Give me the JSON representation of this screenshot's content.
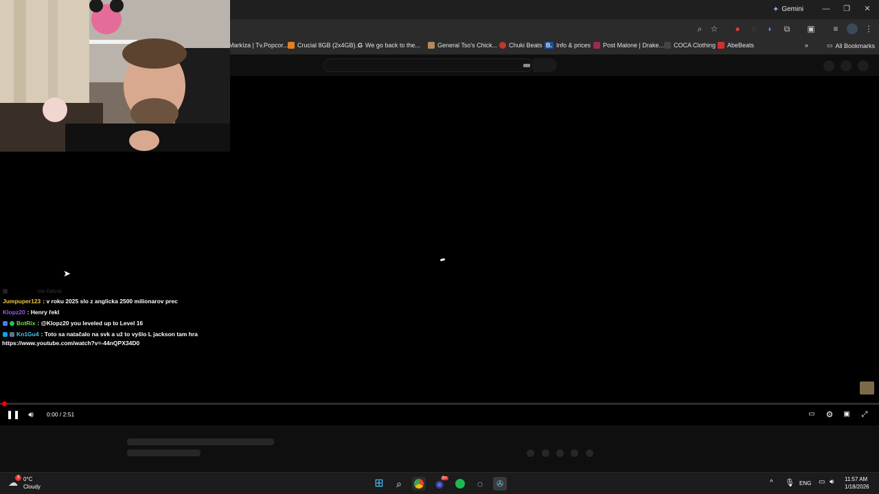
{
  "browser": {
    "gemini_label": "Gemini",
    "bookmarks": [
      {
        "label": "Markíza | Tv.Popcor...",
        "color": "#c0392b"
      },
      {
        "label": "Crucial 8GB (2x4GB)...",
        "color": "#e67e22"
      },
      {
        "label": "We go back to the...",
        "icon": "G"
      },
      {
        "label": "General Tso's Chick...",
        "color": "#b58a5a"
      },
      {
        "label": "Chuki Beats",
        "color": "#c0392b"
      },
      {
        "label": "Info & prices",
        "icon": "B."
      },
      {
        "label": "Post Malone | Drake...",
        "color": "#9b2c4a"
      },
      {
        "label": "COCA Clothing",
        "color": "#444444"
      },
      {
        "label": "AbeBeats",
        "color": "#d32f2f"
      }
    ],
    "all_bookmarks_label": "All Bookmarks"
  },
  "chat": {
    "faded": "nie četval",
    "messages": [
      {
        "user": "Jumpuper123",
        "user_color": "#f2c94c",
        "text": " : v roku 2025 slo z anglicka 2500 milionarov prec"
      },
      {
        "user": "Klopz20",
        "user_color": "#9b59f6",
        "text": " : Henry řekl"
      },
      {
        "user": "BotRix",
        "user_color": "#6fdc4b",
        "text": " : @Klopz20 you leveled up to Level 16"
      },
      {
        "user": "Kn1Gu4",
        "user_color": "#4fc3f7",
        "text": " : Toto sa natačalo na svk a už to vyšlo L jackson tam hra"
      }
    ],
    "link": "https://www.youtube.com/watch?v=-44nQPX34D0"
  },
  "player": {
    "time": "0:00 / 2:51",
    "progress_fraction": 0.0
  },
  "taskbar": {
    "weather_temp": "0°C",
    "weather_desc": "Cloudy",
    "weather_badge": "3",
    "lang": "ENG",
    "clock_time": "11:57 AM",
    "clock_date": "1/18/2026",
    "discord_badge": "9+"
  },
  "colors": {
    "youtube_red": "#ff0000",
    "chrome_dark": "#2b2b2b"
  }
}
